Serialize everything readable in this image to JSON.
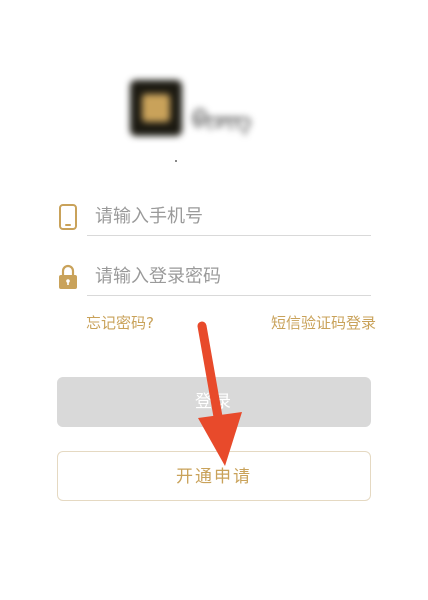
{
  "colors": {
    "accent": "#c9a25a",
    "button_disabled": "#d9d9d9",
    "divider": "#d9d9d9",
    "placeholder": "#9a9a9a",
    "arrow": "#e84a2b"
  },
  "logo": {
    "icon": "app-logo-mark",
    "text": "ᠪᠢᠴᠢᠭ"
  },
  "form": {
    "phone_placeholder": "请输入手机号",
    "password_placeholder": "请输入登录密码",
    "phone_icon": "phone-icon",
    "password_icon": "lock-icon"
  },
  "links": {
    "forgot_password": "忘记密码?",
    "sms_login": "短信验证码登录"
  },
  "buttons": {
    "login": "登录",
    "apply": "开通申请"
  }
}
